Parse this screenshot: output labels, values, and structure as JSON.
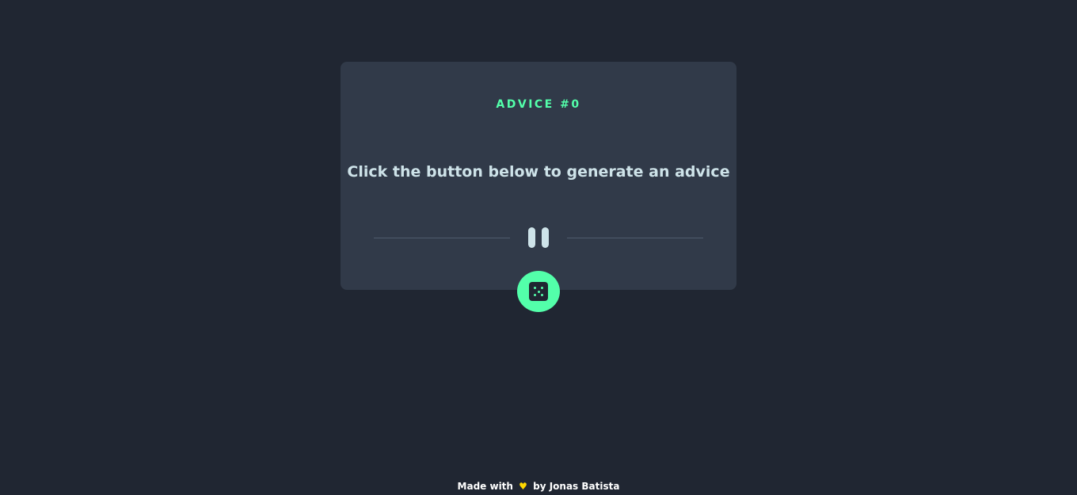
{
  "card": {
    "advice_label": "ADVICE #0",
    "advice_text": "Click the button below to generate an advice"
  },
  "icons": {
    "divider": "pause-icon",
    "button": "dice-icon",
    "heart": "heart-icon"
  },
  "footer": {
    "prefix": "Made with",
    "heart": "♥",
    "suffix": "by Jonas Batista"
  },
  "colors": {
    "background": "#202632",
    "card": "#313a49",
    "accent": "#53ffaa",
    "text": "#cee3e9",
    "divider_line": "#4f5b6e",
    "heart": "#ffd700"
  }
}
